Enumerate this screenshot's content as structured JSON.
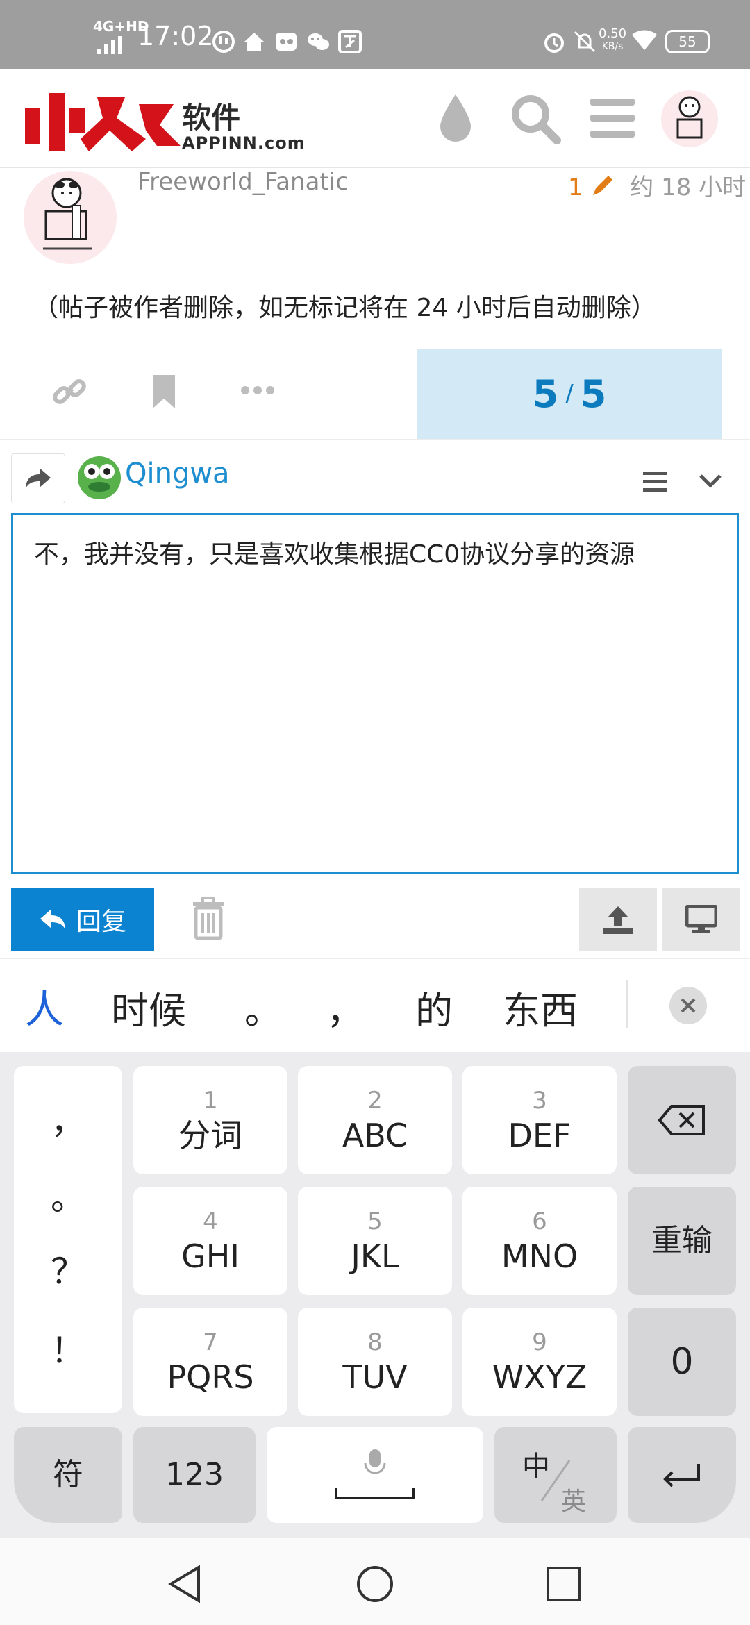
{
  "status_bar": {
    "network": "4G+HD",
    "time": "17:02",
    "speed_value": "0.50",
    "speed_unit": "KB/s",
    "battery": "55"
  },
  "header": {
    "logo_cn": "软件",
    "logo_en": "APPINN.com",
    "icons": [
      "theme-drop-icon",
      "search-icon",
      "menu-icon",
      "user-avatar"
    ]
  },
  "post": {
    "username": "Freeworld_Fanatic",
    "edit_count": "1",
    "time_ago": "约 18 小时",
    "body": "（帖子被作者删除，如无标记将在 24 小时后自动删除）",
    "progress_current": "5",
    "progress_sep": "/",
    "progress_total": "5"
  },
  "composer": {
    "reply_to_user": "Qingwa",
    "content": "不，我并没有，只是喜欢收集根据CC0协议分享的资源",
    "reply_label": "回复"
  },
  "ime": {
    "mode_icon": "人",
    "candidates": [
      "时候",
      "。",
      "，",
      "的",
      "东西"
    ],
    "punctuation": [
      "，",
      "。",
      "？",
      "！"
    ],
    "keys": [
      {
        "num": "1",
        "label": "分词"
      },
      {
        "num": "2",
        "label": "ABC"
      },
      {
        "num": "3",
        "label": "DEF"
      },
      {
        "num": "4",
        "label": "GHI"
      },
      {
        "num": "5",
        "label": "JKL"
      },
      {
        "num": "6",
        "label": "MNO"
      },
      {
        "num": "7",
        "label": "PQRS"
      },
      {
        "num": "8",
        "label": "TUV"
      },
      {
        "num": "9",
        "label": "WXYZ"
      }
    ],
    "reinput": "重输",
    "zero": "0",
    "symbols": "符",
    "numeric": "123",
    "lang_cn": "中",
    "lang_en": "英"
  },
  "colors": {
    "accent": "#0b83d1",
    "progress_bg": "#d3e9f6",
    "edit_orange": "#e27d15",
    "status_bar": "#9e9e9e"
  }
}
